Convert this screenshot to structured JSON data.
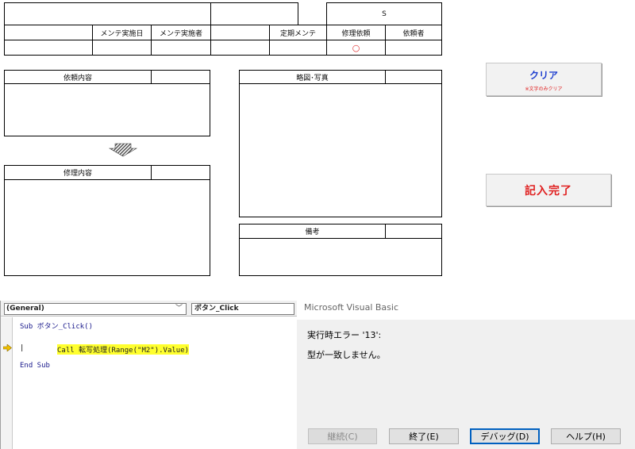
{
  "form": {
    "header": {
      "s_label": "S",
      "columns": [
        "メンテ実施日",
        "メンテ実施者",
        "定期メンテ",
        "修理依頼",
        "依頼者"
      ],
      "repair_mark": "○"
    },
    "request_label": "依頼内容",
    "sketch_label": "略図･写真",
    "repair_label": "修理内容",
    "remarks_label": "備考"
  },
  "buttons": {
    "clear_label": "クリア",
    "clear_note": "※文字のみクリア",
    "done_label": "記入完了"
  },
  "vba": {
    "scope": "(General)",
    "procedure": "ボタン_Click",
    "lines": [
      "Sub ボタン_Click()",
      "Call 転写処理(Range(\"M2\").Value)",
      "End Sub"
    ]
  },
  "dialog": {
    "title": "Microsoft Visual Basic",
    "error": "実行時エラー '13':",
    "message": "型が一致しません。",
    "buttons": [
      "継続(C)",
      "終了(E)",
      "デバッグ(D)",
      "ヘルプ(H)"
    ]
  },
  "colors": {
    "clear_text": "#1f3fcf",
    "done_text": "#e02020",
    "highlight": "#ffff2e",
    "arrow_marker": "#f0c000"
  }
}
